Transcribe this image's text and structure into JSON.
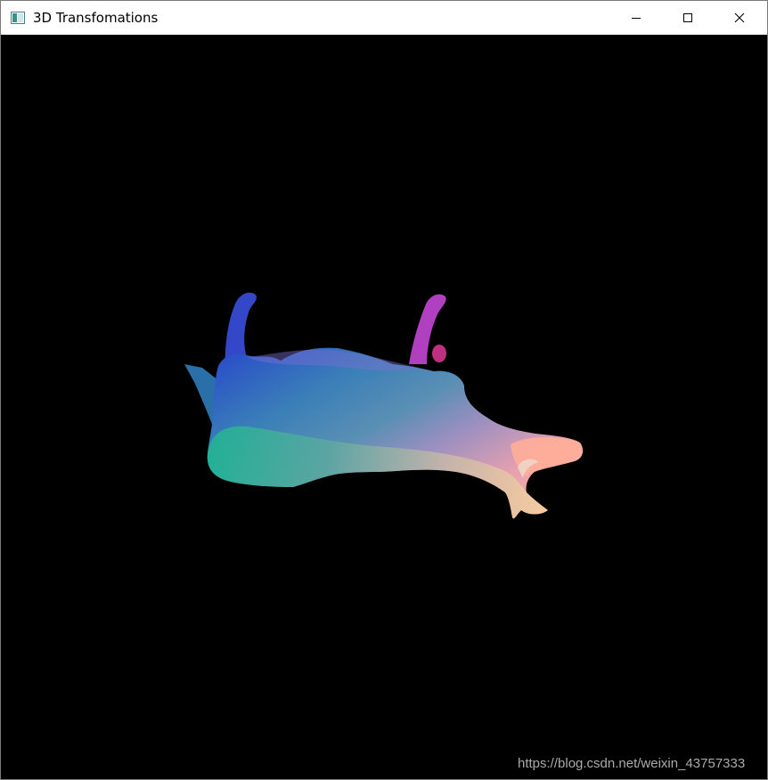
{
  "window": {
    "title": "3D Transfomations",
    "icon": "app-window-icon",
    "controls": {
      "minimize": "minimize-icon",
      "maximize": "maximize-icon",
      "close": "close-icon"
    }
  },
  "viewport": {
    "background": "#000000",
    "model": "cow-mesh"
  },
  "watermark": {
    "text": "https://blog.csdn.net/weixin_43757333"
  }
}
